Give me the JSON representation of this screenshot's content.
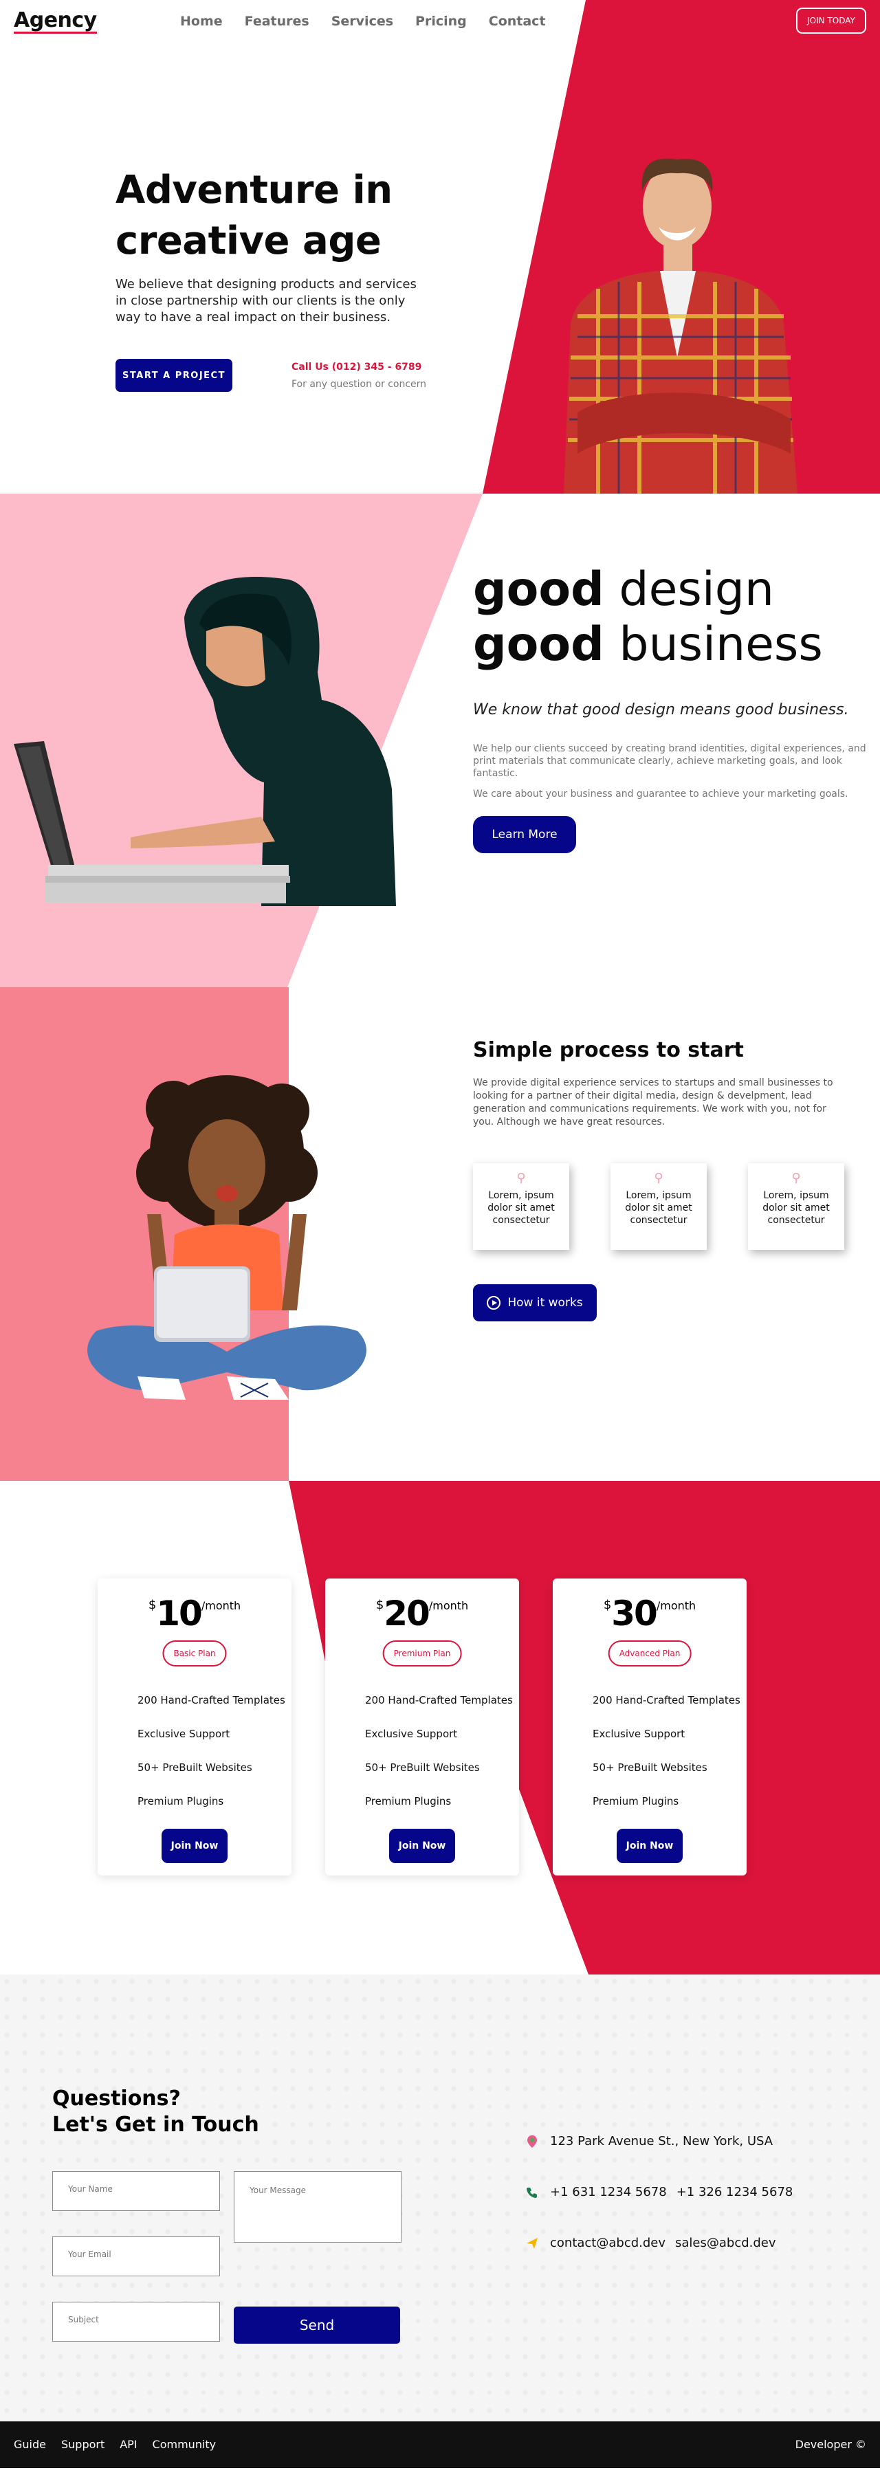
{
  "nav": {
    "logo": "Agency",
    "links": [
      "Home",
      "Features",
      "Services",
      "Pricing",
      "Contact"
    ],
    "cta": "JOIN TODAY"
  },
  "hero": {
    "title_line1": "Adventure in",
    "title_line2": "creative age",
    "lead": "We believe that designing products and services in close partnership with our clients is the only way to have a real impact on their business.",
    "cta": "START A PROJECT",
    "call": "Call Us (012) 345 - 6789",
    "call_sub": "For any question or concern"
  },
  "design": {
    "line1_bold": "good",
    "line1_rest": " design",
    "line2_bold": "good",
    "line2_rest": " business",
    "quote": "We know that good design means good business.",
    "p1": "We help our clients succeed by creating brand identities, digital experiences, and print materials that communicate clearly, achieve marketing goals, and look fantastic.",
    "p2": "We care about your business and guarantee to achieve your marketing goals.",
    "cta": "Learn More"
  },
  "process": {
    "title": "Simple process to start",
    "description": "We provide digital experience services to startups and small businesses to looking for a partner of their digital media, design & develpment, lead generation and communications requirements. We work with you, not for you. Although we have great resources.",
    "cards": [
      "Lorem, ipsum dolor sit amet consectetur",
      "Lorem, ipsum dolor sit amet consectetur",
      "Lorem, ipsum dolor sit amet consectetur"
    ],
    "cta": "How it works"
  },
  "pricing": {
    "plans": [
      {
        "currency": "$",
        "amount": "10",
        "period": "/month",
        "name": "Basic Plan",
        "features": [
          "200 Hand-Crafted Templates",
          "Exclusive Support",
          "50+ PreBuilt Websites",
          "Premium Plugins"
        ],
        "cta": "Join Now"
      },
      {
        "currency": "$",
        "amount": "20",
        "period": "/month",
        "name": "Premium Plan",
        "features": [
          "200 Hand-Crafted Templates",
          "Exclusive Support",
          "50+ PreBuilt Websites",
          "Premium Plugins"
        ],
        "cta": "Join Now"
      },
      {
        "currency": "$",
        "amount": "30",
        "period": "/month",
        "name": "Advanced Plan",
        "features": [
          "200 Hand-Crafted Templates",
          "Exclusive Support",
          "50+ PreBuilt Websites",
          "Premium Plugins"
        ],
        "cta": "Join Now"
      }
    ]
  },
  "contact": {
    "title_line1": "Questions?",
    "title_line2": "Let's Get in Touch",
    "name_placeholder": "Your Name",
    "email_placeholder": "Your Email",
    "subject_placeholder": "Subject",
    "message_placeholder": "Your Message",
    "send": "Send",
    "address": "123 Park Avenue St., New York, USA",
    "phone1": "+1 631 1234 5678",
    "phone2": "+1 326 1234 5678",
    "email1": "contact@abcd.dev",
    "email2": "sales@abcd.dev"
  },
  "footer": {
    "links": [
      "Guide",
      "Support",
      "API",
      "Community"
    ],
    "credit": "Developer ©"
  },
  "colors": {
    "crimson": "#dc143c",
    "navy": "#06068a",
    "pink_light": "#fdbac8",
    "pink_mid": "#f6818f"
  }
}
